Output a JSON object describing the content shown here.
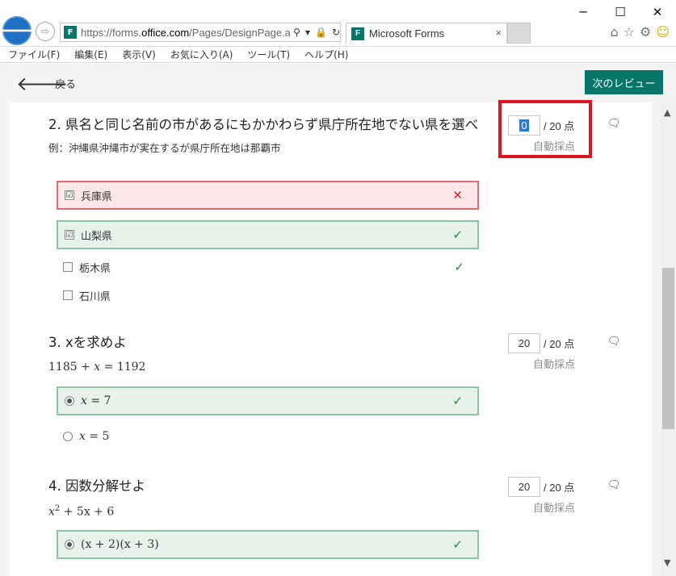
{
  "browser": {
    "url_domain_prefix": "https://forms.",
    "url_domain": "office.com",
    "url_path": "/Pages/DesignPage.aspx",
    "favicon": "F",
    "tab_title": "Microsoft Forms",
    "tab_close": "×",
    "window": {
      "minimize": "─",
      "maximize": "☐",
      "close": "✕"
    },
    "icons": {
      "back": "🡐",
      "forward": "⇨",
      "search": "⚲",
      "dropdown": "▾",
      "lock": "🔒",
      "refresh": "↻",
      "home": "⌂",
      "star": "☆",
      "gear": "⚙",
      "smile": "☺"
    }
  },
  "menu": [
    "ファイル(F)",
    "編集(E)",
    "表示(V)",
    "お気に入り(A)",
    "ツール(T)",
    "ヘルプ(H)"
  ],
  "formbar": {
    "back_arrow": "🡐",
    "back_label": "戻る",
    "next_label": "次のレビュー"
  },
  "questions": [
    {
      "number": "2.",
      "title": "県名と同じ名前の市があるにもかかわらず県庁所在地でない県を選べ",
      "subtitle": "例：沖縄県沖縄市が実在するが県庁所在地は那覇市",
      "score": "0",
      "total": "/ 20 点",
      "auto": "自動採点",
      "options": [
        {
          "label": "兵庫県",
          "checked": "☑",
          "mark": "✕"
        },
        {
          "label": "山梨県",
          "checked": "☑",
          "mark": "✓"
        },
        {
          "label": "栃木県",
          "mark": "✓"
        },
        {
          "label": "石川県"
        }
      ]
    },
    {
      "number": "3.",
      "title": "xを求めよ",
      "equation": {
        "a": "1185",
        "op": "+",
        "var": "x",
        "eq": "=",
        "b": "1192"
      },
      "score": "20",
      "total": "/ 20 点",
      "auto": "自動採点",
      "options": [
        {
          "var": "x",
          "eq": "=",
          "val": "7",
          "mark": "✓"
        },
        {
          "var": "x",
          "eq": "=",
          "val": "5"
        }
      ]
    },
    {
      "number": "4.",
      "title": "因数分解せよ",
      "equation": {
        "base": "x",
        "exp": "2",
        "rest": "+ 5x + 6"
      },
      "score": "20",
      "total": "/ 20 点",
      "auto": "自動採点",
      "options": [
        {
          "label": "(x + 2)(x + 3)",
          "mark": "✓"
        }
      ]
    }
  ],
  "comment_icon": "🗨",
  "scroll": {
    "up": "▲",
    "down": "▼"
  },
  "colors": {
    "accent": "#077568",
    "wrong": "#d9252b",
    "correct": "#1e8a3a",
    "highlight": "#e0141e"
  }
}
